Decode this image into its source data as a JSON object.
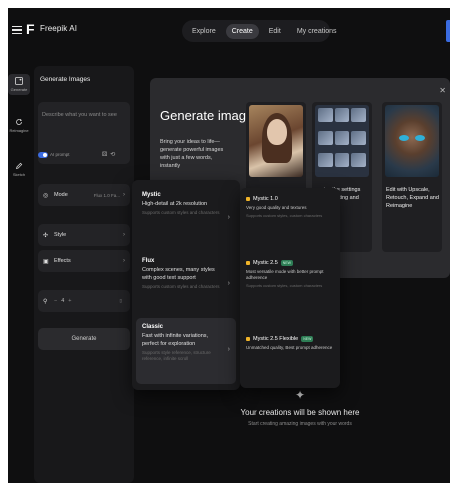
{
  "topbar": {
    "logo_text": "Freepik AI",
    "tabs": [
      {
        "label": "Explore",
        "active": false
      },
      {
        "label": "Create",
        "active": true
      },
      {
        "label": "Edit",
        "active": false
      },
      {
        "label": "My creations",
        "active": false
      }
    ]
  },
  "rail": {
    "items": [
      {
        "label": "Generate",
        "icon": "image-icon"
      },
      {
        "label": "Reimagine",
        "icon": "refresh-icon"
      },
      {
        "label": "Sketch",
        "icon": "pencil-icon"
      }
    ]
  },
  "panel": {
    "title": "Generate Images",
    "prompt_placeholder": "Describe what you want to see",
    "toggle_label": "AI prompt",
    "mode": {
      "label": "Mode",
      "value": "Flux 1.0 Fa..."
    },
    "style": {
      "label": "Style"
    },
    "effects": {
      "label": "Effects"
    },
    "count": {
      "value": "4"
    },
    "generate_label": "Generate"
  },
  "promo": {
    "title": "Generate images",
    "description": "Bring your ideas to life—generate powerful images with just a few words, instantly",
    "card2_text": "...nise the settings ...les, lighting and",
    "card3_text": "Edit with Upscale, Retouch, Expand and Reimagine"
  },
  "empty_state": {
    "title": "Your creations will be shown here",
    "subtitle": "Start creating amazing images with your words"
  },
  "model_menu": {
    "items": [
      {
        "name": "Mystic",
        "desc": "High-detail at 2k resolution",
        "sub": "Supports custom styles and characters"
      },
      {
        "name": "Flux",
        "desc": "Complex scenes, many styles with good text support",
        "sub": "Supports custom styles and characters"
      },
      {
        "name": "Classic",
        "desc": "Fast with infinite variations, perfect for exploration",
        "sub": "Supports style reference, structure reference, infinite scroll"
      }
    ]
  },
  "mystic_submenu": {
    "items": [
      {
        "name": "Mystic 1.0",
        "badge": "",
        "desc": "Very good quality and textures",
        "sub": "Supports custom styles, custom characters"
      },
      {
        "name": "Mystic 2.5",
        "badge": "NEW",
        "desc": "Most versatile mode with better prompt adherence",
        "sub": "Supports custom styles, custom characters"
      },
      {
        "name": "Mystic 2.5 Flexible",
        "badge": "NEW",
        "desc": "Unmatched quality, Best prompt adherence",
        "sub": ""
      }
    ]
  },
  "colors": {
    "background": "#0f0f10",
    "panel": "#18181a",
    "accent_blue": "#3b6be0",
    "badge_green": "#2e7d55",
    "dot_yellow": "#f0b429"
  }
}
